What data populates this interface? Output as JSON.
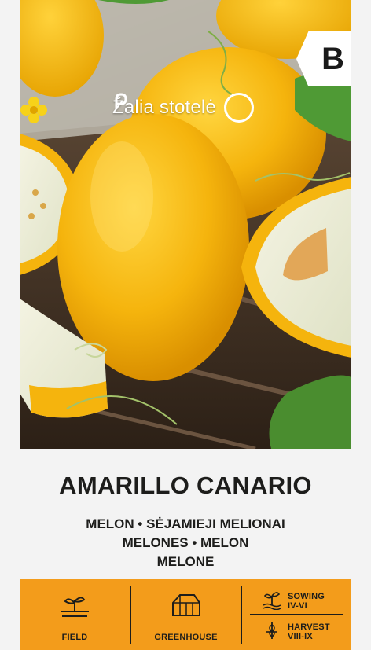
{
  "brand": {
    "name": "Žalia stotelė"
  },
  "badge": {
    "letter": "B"
  },
  "product": {
    "title": "AMARILLO CANARIO",
    "subtitle_lines": [
      "MELON • SĖJAMIEJI MELIONAI",
      "MELONES • MELON",
      "MELONE"
    ]
  },
  "info_bar": {
    "field_label": "FIELD",
    "greenhouse_label": "GREENHOUSE",
    "sowing_label": "SOWING",
    "sowing_months": "IV-VI",
    "harvest_label": "HARVEST",
    "harvest_months": "VIII-IX"
  },
  "colors": {
    "info_bar_bg": "#f39c1b",
    "melon_yellow": "#f7b912",
    "text_dark": "#1d1d1b"
  },
  "icons": [
    "field-icon",
    "greenhouse-icon",
    "sowing-icon",
    "harvest-icon",
    "brand-logo-icon"
  ]
}
